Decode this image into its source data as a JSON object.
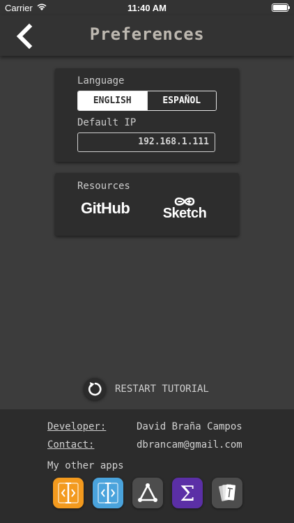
{
  "status_bar": {
    "carrier": "Carrier",
    "time": "11:40 AM",
    "battery_level": 1.0
  },
  "nav": {
    "title": "Preferences",
    "back_icon": "chevron-left-icon"
  },
  "language_card": {
    "label": "Language",
    "options": [
      "ENGLISH",
      "ESPAÑOL"
    ],
    "selected": "ENGLISH",
    "ip_label": "Default IP",
    "ip_value": "192.168.1.111"
  },
  "resources_card": {
    "label": "Resources",
    "github_label": "GitHub",
    "sketch_label": "Sketch"
  },
  "restart": {
    "label": "RESTART TUTORIAL",
    "icon": "restart-icon"
  },
  "footer": {
    "developer_key": "Developer:",
    "developer_value": "David Braña Campos",
    "contact_key": "Contact:",
    "contact_value": "dbrancam@gmail.com",
    "apps_label": "My other apps",
    "apps": [
      {
        "name": "orange-app-icon",
        "color": "#f39a1e"
      },
      {
        "name": "blue-app-icon",
        "color": "#4aa3dc"
      },
      {
        "name": "triangle-app-icon",
        "color": "#4d4d4d"
      },
      {
        "name": "sigma-app-icon",
        "color": "#5b2fa6"
      },
      {
        "name": "cards-app-icon",
        "color": "#4d4d4d"
      }
    ]
  },
  "colors": {
    "background": "#3c3c3c",
    "bar": "#333333",
    "card": "#2d2d2d",
    "footer": "#2c2c2c"
  }
}
